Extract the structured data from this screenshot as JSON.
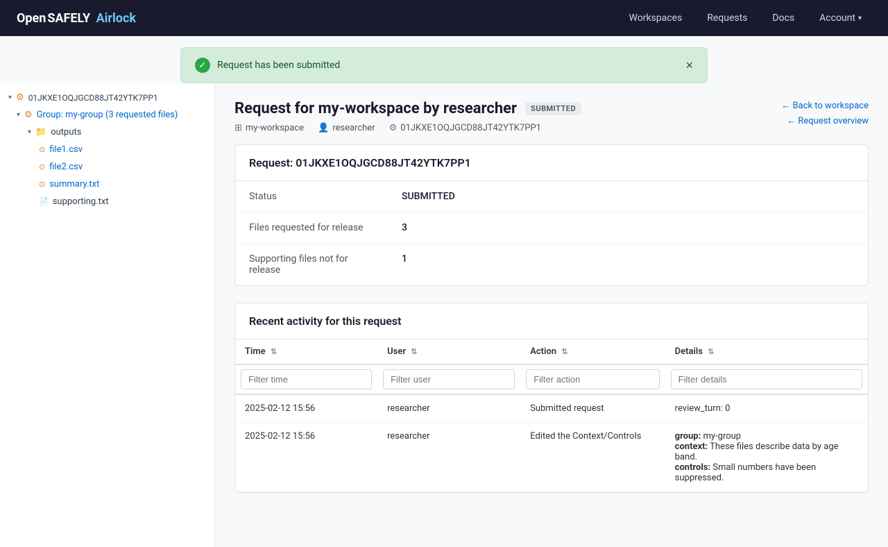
{
  "brand": {
    "open": "Open",
    "safely": "SAFELY",
    "airlock": "Airlock"
  },
  "nav": {
    "links": [
      "Workspaces",
      "Requests",
      "Docs"
    ],
    "account": "Account"
  },
  "alert": {
    "message": "Request has been submitted",
    "close": "×"
  },
  "pageHeader": {
    "title": "Request for my-workspace by researcher",
    "status": "SUBMITTED",
    "meta": {
      "workspace": "my-workspace",
      "user": "researcher",
      "requestId": "01JKXE1OQJGCD88JT42YTK7PP1"
    },
    "backToWorkspace": "← Back to workspace",
    "requestOverview": "← Request overview"
  },
  "requestPanel": {
    "title": "Request: 01JKXE1OQJGCD88JT42YTK7PP1",
    "rows": [
      {
        "label": "Status",
        "value": "SUBMITTED"
      },
      {
        "label": "Files requested for release",
        "value": "3"
      },
      {
        "label": "Supporting files not for release",
        "value": "1"
      }
    ]
  },
  "activitySection": {
    "title": "Recent activity for this request",
    "columns": [
      {
        "label": "Time",
        "sort": "⇅"
      },
      {
        "label": "User",
        "sort": "⇅"
      },
      {
        "label": "Action",
        "sort": "⇅"
      },
      {
        "label": "Details",
        "sort": "⇅"
      }
    ],
    "filters": {
      "time": "Filter time",
      "user": "Filter user",
      "action": "Filter action",
      "details": "Filter details"
    },
    "rows": [
      {
        "time": "2025-02-12 15:56",
        "user": "researcher",
        "action": "Submitted request",
        "details": "review_turn: 0"
      },
      {
        "time": "2025-02-12 15:56",
        "user": "researcher",
        "action": "Edited the Context/Controls",
        "details": "group: my-group\ncontext: These files describe data by age band.\ncontrols: Small numbers have been suppressed."
      }
    ]
  },
  "sidebar": {
    "rootId": "01JKXE1OQJGCD88JT42YTK7PP1",
    "groupLabel": "Group: my-group (3 requested files)",
    "outputsFolder": "outputs",
    "files": [
      {
        "name": "file1.csv",
        "type": "csv"
      },
      {
        "name": "file2.csv",
        "type": "csv"
      },
      {
        "name": "summary.txt",
        "type": "txt"
      },
      {
        "name": "supporting.txt",
        "type": "txt-plain"
      }
    ]
  }
}
